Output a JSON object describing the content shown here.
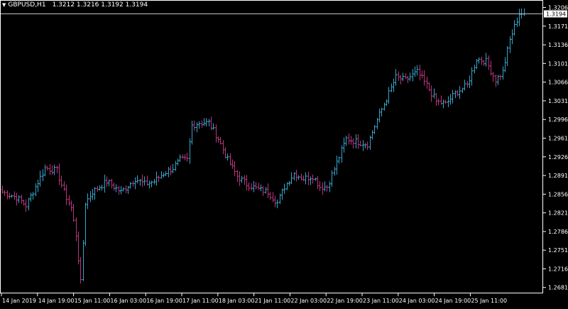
{
  "header": {
    "dropdown_icon": "triangle-down-icon",
    "symbol": "GBPUSD,H1",
    "ohlc": "1.3212 1.3216 1.3192 1.3194"
  },
  "current_price": "1.3194",
  "colors": {
    "background": "#000000",
    "bull": "#36a3c9",
    "bear": "#b8357c",
    "frame": "#ffffff",
    "price_line": "#c0c0c0"
  },
  "chart_data": {
    "type": "ohlc",
    "ylim": [
      1.267,
      1.322
    ],
    "price_scale": [
      "1.3206",
      "1.3171",
      "1.3136",
      "1.3101",
      "1.3066",
      "1.3031",
      "1.2996",
      "1.2961",
      "1.2926",
      "1.2891",
      "1.2856",
      "1.2821",
      "1.2786",
      "1.2751",
      "1.2716",
      "1.2681"
    ],
    "time_scale": [
      "14 Jan 2019",
      "14 Jan 19:00",
      "15 Jan 11:00",
      "16 Jan 03:00",
      "16 Jan 19:00",
      "17 Jan 11:00",
      "18 Jan 03:00",
      "21 Jan 11:00",
      "22 Jan 03:00",
      "22 Jan 19:00",
      "23 Jan 11:00",
      "24 Jan 03:00",
      "24 Jan 19:00",
      "25 Jan 11:00"
    ],
    "anchors": [
      [
        0,
        1.286
      ],
      [
        6,
        1.285
      ],
      [
        10,
        1.2835
      ],
      [
        14,
        1.287
      ],
      [
        18,
        1.2905
      ],
      [
        23,
        1.29
      ],
      [
        26,
        1.286
      ],
      [
        29,
        1.283
      ],
      [
        31,
        1.278
      ],
      [
        33,
        1.269
      ],
      [
        35,
        1.284
      ],
      [
        38,
        1.286
      ],
      [
        44,
        1.288
      ],
      [
        50,
        1.286
      ],
      [
        56,
        1.2885
      ],
      [
        60,
        1.2875
      ],
      [
        64,
        1.288
      ],
      [
        68,
        1.2895
      ],
      [
        72,
        1.2905
      ],
      [
        75,
        1.292
      ],
      [
        78,
        1.292
      ],
      [
        80,
        1.2985
      ],
      [
        83,
        1.299
      ],
      [
        87,
        1.299
      ],
      [
        91,
        1.296
      ],
      [
        95,
        1.292
      ],
      [
        99,
        1.289
      ],
      [
        103,
        1.2875
      ],
      [
        108,
        1.2865
      ],
      [
        112,
        1.286
      ],
      [
        116,
        1.284
      ],
      [
        119,
        1.287
      ],
      [
        123,
        1.2895
      ],
      [
        127,
        1.2885
      ],
      [
        131,
        1.289
      ],
      [
        134,
        1.287
      ],
      [
        137,
        1.287
      ],
      [
        141,
        1.2915
      ],
      [
        145,
        1.296
      ],
      [
        149,
        1.2955
      ],
      [
        154,
        1.295
      ],
      [
        158,
        1.2995
      ],
      [
        162,
        1.3035
      ],
      [
        166,
        1.3075
      ],
      [
        170,
        1.307
      ],
      [
        175,
        1.3085
      ],
      [
        179,
        1.306
      ],
      [
        183,
        1.303
      ],
      [
        187,
        1.3025
      ],
      [
        191,
        1.3045
      ],
      [
        196,
        1.306
      ],
      [
        200,
        1.311
      ],
      [
        204,
        1.3105
      ],
      [
        208,
        1.307
      ],
      [
        211,
        1.3085
      ],
      [
        214,
        1.3145
      ],
      [
        218,
        1.3195
      ],
      [
        220,
        1.3194
      ]
    ]
  }
}
